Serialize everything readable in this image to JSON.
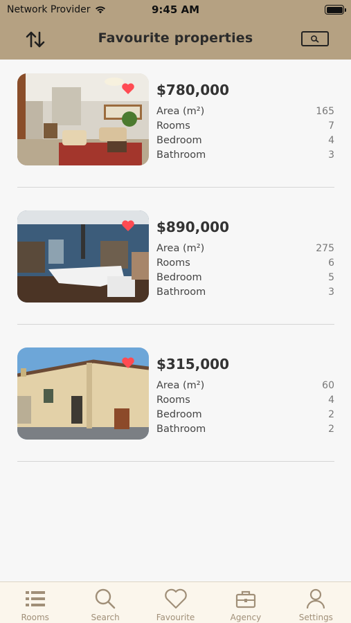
{
  "status_bar": {
    "carrier": "Network Provider",
    "time": "9:45 AM"
  },
  "header": {
    "title": "Favourite properties",
    "sort_icon": "sort-arrows-icon",
    "search_icon": "search-icon"
  },
  "colors": {
    "header_bg": "#b5a182",
    "tabbar_bg": "#fbf6ec",
    "tab_inactive": "#a08f78",
    "heart": "#ff4b52"
  },
  "labels": {
    "area": "Area (m²)",
    "rooms": "Rooms",
    "bedroom": "Bedroom",
    "bathroom": "Bathroom"
  },
  "properties": [
    {
      "price": "$780,000",
      "area": "165",
      "rooms": "7",
      "bedroom": "4",
      "bathroom": "3",
      "favourite": true
    },
    {
      "price": "$890,000",
      "area": "275",
      "rooms": "6",
      "bedroom": "5",
      "bathroom": "3",
      "favourite": true
    },
    {
      "price": "$315,000",
      "area": "60",
      "rooms": "4",
      "bedroom": "2",
      "bathroom": "2",
      "favourite": true
    }
  ],
  "tabs": [
    {
      "label": "Rooms",
      "icon": "list-icon"
    },
    {
      "label": "Search",
      "icon": "search-icon"
    },
    {
      "label": "Favourite",
      "icon": "heart-icon"
    },
    {
      "label": "Agency",
      "icon": "briefcase-icon"
    },
    {
      "label": "Settings",
      "icon": "person-icon"
    }
  ]
}
